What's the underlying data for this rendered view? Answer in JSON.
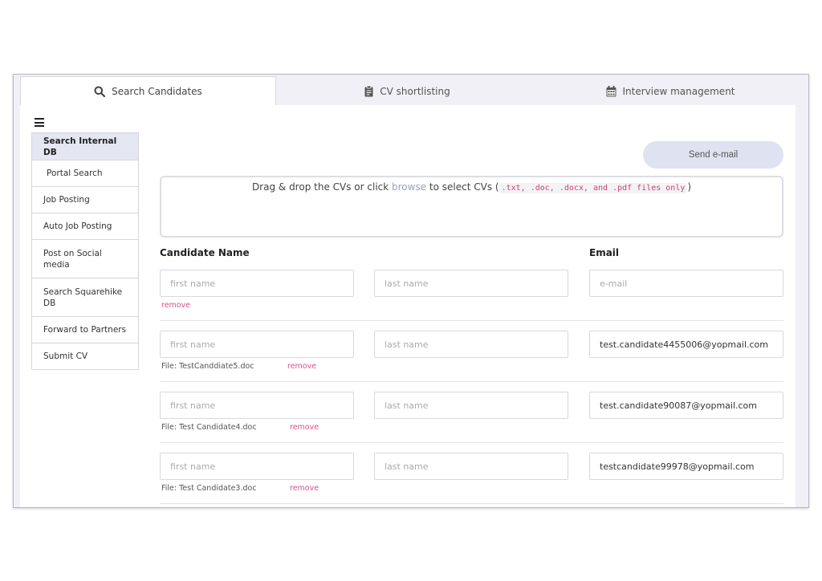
{
  "tabs": [
    {
      "label": "Search Candidates",
      "icon": "search-icon"
    },
    {
      "label": "CV shortlisting",
      "icon": "clipboard-icon"
    },
    {
      "label": "Interview management",
      "icon": "calendar-icon"
    }
  ],
  "sidebar": {
    "items": [
      {
        "label": "Search Internal DB"
      },
      {
        "label": "Portal Search"
      },
      {
        "label": "Job Posting"
      },
      {
        "label": "Auto Job Posting"
      },
      {
        "label": "Post on Social media"
      },
      {
        "label": "Search Squarehike DB"
      },
      {
        "label": "Forward to Partners"
      },
      {
        "label": "Submit CV"
      }
    ]
  },
  "toolbar": {
    "send_email_label": "Send e-mail"
  },
  "dropzone": {
    "prefix": "Drag & drop the CVs or click ",
    "browse": "browse",
    "middle": " to select CVs (",
    "formats": ".txt, .doc, .docx, and .pdf files only",
    "suffix": ")"
  },
  "headers": {
    "candidate_name": "Candidate Name",
    "email": "Email"
  },
  "placeholders": {
    "first": "first name",
    "last": "last name",
    "email": "e-mail"
  },
  "remove_label": "remove",
  "candidates": [
    {
      "first": "",
      "last": "",
      "email": "",
      "file": ""
    },
    {
      "first": "",
      "last": "",
      "email": "test.candidate4455006@yopmail.com",
      "file": "File: TestCanddiate5.doc"
    },
    {
      "first": "",
      "last": "",
      "email": "test.candidate90087@yopmail.com",
      "file": "File: Test Candidate4.doc"
    },
    {
      "first": "",
      "last": "",
      "email": "testcandidate99978@yopmail.com",
      "file": "File: Test Candidate3.doc"
    }
  ]
}
